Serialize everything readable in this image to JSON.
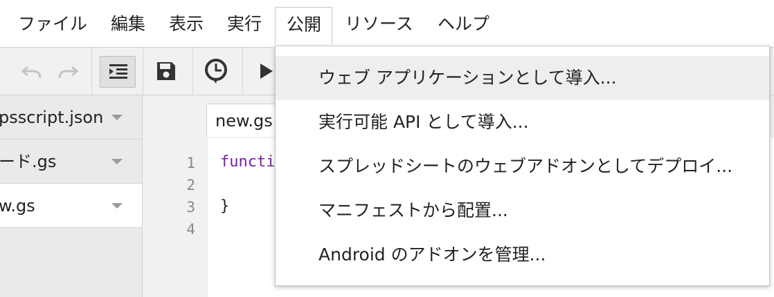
{
  "menubar": {
    "items": [
      {
        "label": "ファイル"
      },
      {
        "label": "編集"
      },
      {
        "label": "表示"
      },
      {
        "label": "実行"
      },
      {
        "label": "公開"
      },
      {
        "label": "リソース"
      },
      {
        "label": "ヘルプ"
      }
    ],
    "active_index": 4
  },
  "toolbar": {
    "icons": [
      "undo-icon",
      "redo-icon",
      "indent-icon",
      "save-icon",
      "triggers-clock-icon",
      "run-play-icon"
    ]
  },
  "files": [
    {
      "name": "appsscript.json",
      "visible_text": "psscript.json"
    },
    {
      "name": "コード.gs",
      "visible_text": "ード.gs"
    },
    {
      "name": "new.gs",
      "visible_text": "w.gs",
      "selected": true
    }
  ],
  "editor": {
    "tab_label": "new.gs",
    "line_numbers": [
      "1",
      "2",
      "3",
      "4"
    ],
    "code_line_1": "functi",
    "code_line_3": "}"
  },
  "publish_menu": {
    "items": [
      {
        "label": "ウェブ アプリケーションとして導入..."
      },
      {
        "label": "実行可能 API として導入..."
      },
      {
        "label": "スプレッドシートのウェブアドオンとしてデプロイ..."
      },
      {
        "label": "マニフェストから配置..."
      },
      {
        "label": "Android のアドオンを管理..."
      }
    ],
    "highlighted_index": 0
  },
  "colors": {
    "keyword": "#7a1fa2",
    "toolbar_bg": "#f1f1f1",
    "highlight": "#eeeeee"
  }
}
